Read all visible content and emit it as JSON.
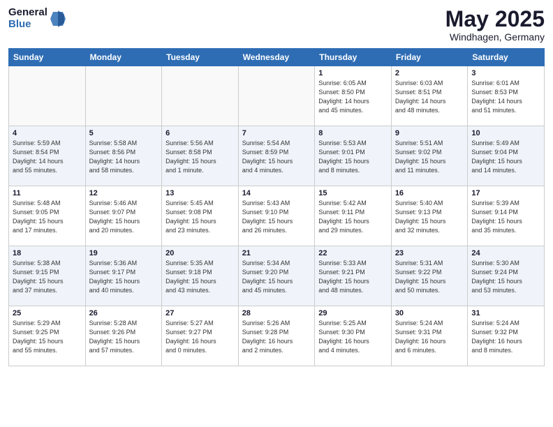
{
  "header": {
    "logo": {
      "general": "General",
      "blue": "Blue"
    },
    "title": "May 2025",
    "subtitle": "Windhagen, Germany"
  },
  "calendar": {
    "days_of_week": [
      "Sunday",
      "Monday",
      "Tuesday",
      "Wednesday",
      "Thursday",
      "Friday",
      "Saturday"
    ],
    "weeks": [
      [
        {
          "day": "",
          "detail": ""
        },
        {
          "day": "",
          "detail": ""
        },
        {
          "day": "",
          "detail": ""
        },
        {
          "day": "",
          "detail": ""
        },
        {
          "day": "1",
          "detail": "Sunrise: 6:05 AM\nSunset: 8:50 PM\nDaylight: 14 hours\nand 45 minutes."
        },
        {
          "day": "2",
          "detail": "Sunrise: 6:03 AM\nSunset: 8:51 PM\nDaylight: 14 hours\nand 48 minutes."
        },
        {
          "day": "3",
          "detail": "Sunrise: 6:01 AM\nSunset: 8:53 PM\nDaylight: 14 hours\nand 51 minutes."
        }
      ],
      [
        {
          "day": "4",
          "detail": "Sunrise: 5:59 AM\nSunset: 8:54 PM\nDaylight: 14 hours\nand 55 minutes."
        },
        {
          "day": "5",
          "detail": "Sunrise: 5:58 AM\nSunset: 8:56 PM\nDaylight: 14 hours\nand 58 minutes."
        },
        {
          "day": "6",
          "detail": "Sunrise: 5:56 AM\nSunset: 8:58 PM\nDaylight: 15 hours\nand 1 minute."
        },
        {
          "day": "7",
          "detail": "Sunrise: 5:54 AM\nSunset: 8:59 PM\nDaylight: 15 hours\nand 4 minutes."
        },
        {
          "day": "8",
          "detail": "Sunrise: 5:53 AM\nSunset: 9:01 PM\nDaylight: 15 hours\nand 8 minutes."
        },
        {
          "day": "9",
          "detail": "Sunrise: 5:51 AM\nSunset: 9:02 PM\nDaylight: 15 hours\nand 11 minutes."
        },
        {
          "day": "10",
          "detail": "Sunrise: 5:49 AM\nSunset: 9:04 PM\nDaylight: 15 hours\nand 14 minutes."
        }
      ],
      [
        {
          "day": "11",
          "detail": "Sunrise: 5:48 AM\nSunset: 9:05 PM\nDaylight: 15 hours\nand 17 minutes."
        },
        {
          "day": "12",
          "detail": "Sunrise: 5:46 AM\nSunset: 9:07 PM\nDaylight: 15 hours\nand 20 minutes."
        },
        {
          "day": "13",
          "detail": "Sunrise: 5:45 AM\nSunset: 9:08 PM\nDaylight: 15 hours\nand 23 minutes."
        },
        {
          "day": "14",
          "detail": "Sunrise: 5:43 AM\nSunset: 9:10 PM\nDaylight: 15 hours\nand 26 minutes."
        },
        {
          "day": "15",
          "detail": "Sunrise: 5:42 AM\nSunset: 9:11 PM\nDaylight: 15 hours\nand 29 minutes."
        },
        {
          "day": "16",
          "detail": "Sunrise: 5:40 AM\nSunset: 9:13 PM\nDaylight: 15 hours\nand 32 minutes."
        },
        {
          "day": "17",
          "detail": "Sunrise: 5:39 AM\nSunset: 9:14 PM\nDaylight: 15 hours\nand 35 minutes."
        }
      ],
      [
        {
          "day": "18",
          "detail": "Sunrise: 5:38 AM\nSunset: 9:15 PM\nDaylight: 15 hours\nand 37 minutes."
        },
        {
          "day": "19",
          "detail": "Sunrise: 5:36 AM\nSunset: 9:17 PM\nDaylight: 15 hours\nand 40 minutes."
        },
        {
          "day": "20",
          "detail": "Sunrise: 5:35 AM\nSunset: 9:18 PM\nDaylight: 15 hours\nand 43 minutes."
        },
        {
          "day": "21",
          "detail": "Sunrise: 5:34 AM\nSunset: 9:20 PM\nDaylight: 15 hours\nand 45 minutes."
        },
        {
          "day": "22",
          "detail": "Sunrise: 5:33 AM\nSunset: 9:21 PM\nDaylight: 15 hours\nand 48 minutes."
        },
        {
          "day": "23",
          "detail": "Sunrise: 5:31 AM\nSunset: 9:22 PM\nDaylight: 15 hours\nand 50 minutes."
        },
        {
          "day": "24",
          "detail": "Sunrise: 5:30 AM\nSunset: 9:24 PM\nDaylight: 15 hours\nand 53 minutes."
        }
      ],
      [
        {
          "day": "25",
          "detail": "Sunrise: 5:29 AM\nSunset: 9:25 PM\nDaylight: 15 hours\nand 55 minutes."
        },
        {
          "day": "26",
          "detail": "Sunrise: 5:28 AM\nSunset: 9:26 PM\nDaylight: 15 hours\nand 57 minutes."
        },
        {
          "day": "27",
          "detail": "Sunrise: 5:27 AM\nSunset: 9:27 PM\nDaylight: 16 hours\nand 0 minutes."
        },
        {
          "day": "28",
          "detail": "Sunrise: 5:26 AM\nSunset: 9:28 PM\nDaylight: 16 hours\nand 2 minutes."
        },
        {
          "day": "29",
          "detail": "Sunrise: 5:25 AM\nSunset: 9:30 PM\nDaylight: 16 hours\nand 4 minutes."
        },
        {
          "day": "30",
          "detail": "Sunrise: 5:24 AM\nSunset: 9:31 PM\nDaylight: 16 hours\nand 6 minutes."
        },
        {
          "day": "31",
          "detail": "Sunrise: 5:24 AM\nSunset: 9:32 PM\nDaylight: 16 hours\nand 8 minutes."
        }
      ]
    ]
  }
}
